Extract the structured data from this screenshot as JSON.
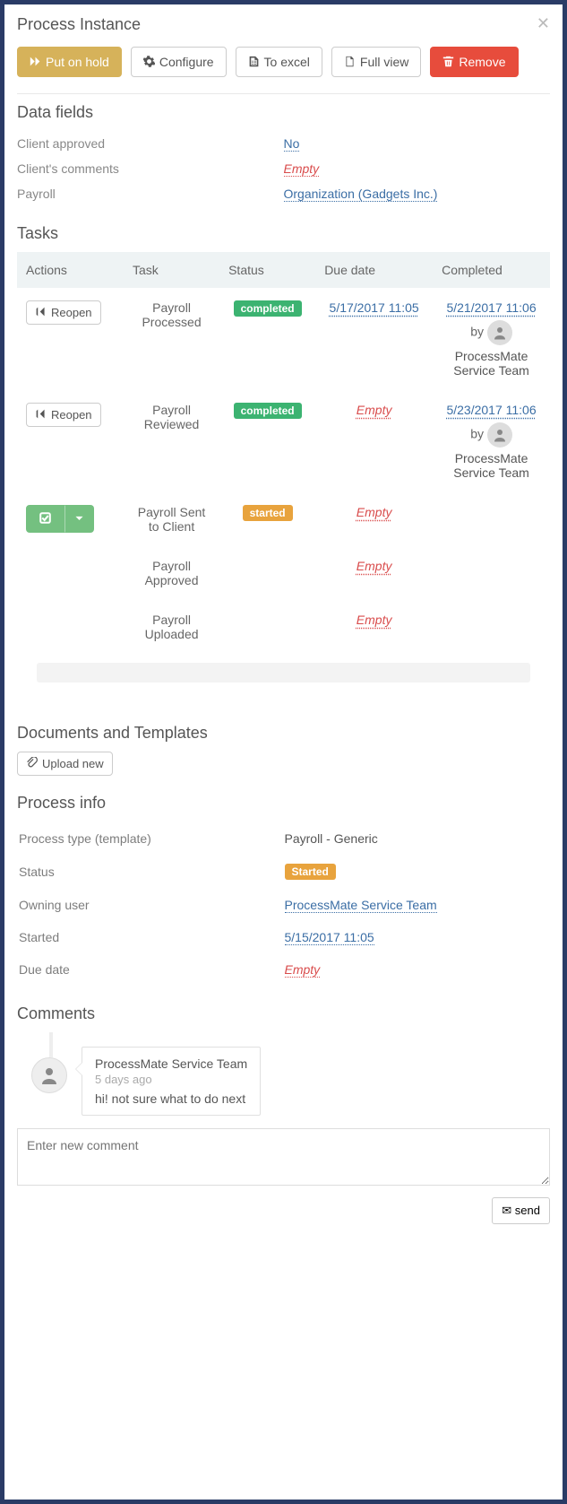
{
  "title": "Process Instance",
  "toolbar": {
    "put_on_hold": "Put on hold",
    "configure": "Configure",
    "to_excel": "To excel",
    "full_view": "Full view",
    "remove": "Remove"
  },
  "data_fields": {
    "heading": "Data fields",
    "rows": [
      {
        "label": "Client approved",
        "value": "No",
        "kind": "link"
      },
      {
        "label": "Client's comments",
        "value": "Empty",
        "kind": "empty"
      },
      {
        "label": "Payroll",
        "value": "Organization (Gadgets Inc.)",
        "kind": "link"
      }
    ]
  },
  "tasks": {
    "heading": "Tasks",
    "columns": [
      "Actions",
      "Task",
      "Status",
      "Due date",
      "Completed"
    ],
    "reopen_label": "Reopen",
    "by_label": "by",
    "rows": [
      {
        "action": "reopen",
        "task": "Payroll Processed",
        "status": "completed",
        "due": "5/17/2017 11:05",
        "due_kind": "link",
        "completed": "5/21/2017 11:06",
        "completed_by": "ProcessMate Service Team"
      },
      {
        "action": "reopen",
        "task": "Payroll Reviewed",
        "status": "completed",
        "due": "Empty",
        "due_kind": "empty",
        "completed": "5/23/2017 11:06",
        "completed_by": "ProcessMate Service Team"
      },
      {
        "action": "check",
        "task": "Payroll Sent to Client",
        "status": "started",
        "due": "Empty",
        "due_kind": "empty",
        "completed": "",
        "completed_by": ""
      },
      {
        "action": "",
        "task": "Payroll Approved",
        "status": "",
        "due": "Empty",
        "due_kind": "empty",
        "completed": "",
        "completed_by": ""
      },
      {
        "action": "",
        "task": "Payroll Uploaded",
        "status": "",
        "due": "Empty",
        "due_kind": "empty",
        "completed": "",
        "completed_by": ""
      }
    ]
  },
  "documents": {
    "heading": "Documents and Templates",
    "upload_label": "Upload new"
  },
  "process_info": {
    "heading": "Process info",
    "rows": [
      {
        "label": "Process type (template)",
        "value": "Payroll - Generic",
        "kind": "text"
      },
      {
        "label": "Status",
        "value": "Started",
        "kind": "badge-started"
      },
      {
        "label": "Owning user",
        "value": "ProcessMate Service Team",
        "kind": "link"
      },
      {
        "label": "Started",
        "value": "5/15/2017 11:05",
        "kind": "link"
      },
      {
        "label": "Due date",
        "value": "Empty",
        "kind": "empty"
      }
    ]
  },
  "comments": {
    "heading": "Comments",
    "items": [
      {
        "author": "ProcessMate Service Team",
        "time": "5 days ago",
        "text": "hi! not sure what to do next"
      }
    ],
    "placeholder": "Enter new comment",
    "send_label": "send"
  }
}
